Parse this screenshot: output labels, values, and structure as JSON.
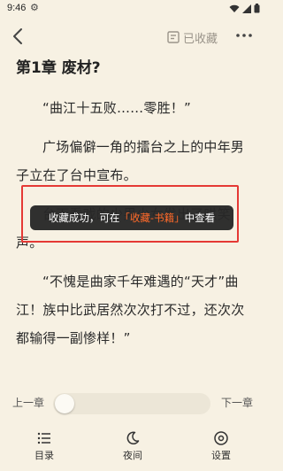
{
  "status": {
    "time": "9:46"
  },
  "toolbar": {
    "bookmark_label": "已收藏"
  },
  "chapter": {
    "title": "第1章  废材?",
    "paragraphs": [
      "“曲江十五败……零胜！”",
      "广场偏僻一角的擂台之上的中年男子立在了台中宣布。",
      "台下看戏的少男少女发出了哄笑声。",
      "“不愧是曲家千年难遇的“天才”曲江！族中比武居然次次打不过，还次次都输得一副惨样！”"
    ]
  },
  "toast": {
    "prefix": "收藏成功，可在",
    "highlight": "「收藏-书籍」",
    "suffix": "中查看",
    "highlight_color": "#ff6a2a"
  },
  "progress": {
    "prev_label": "上一章",
    "next_label": "下一章",
    "value": 0.0
  },
  "bottom_nav": {
    "catalog": "目录",
    "night": "夜间",
    "settings": "设置"
  },
  "colors": {
    "background": "#f7f1e3",
    "toast_outline": "#e53935"
  }
}
